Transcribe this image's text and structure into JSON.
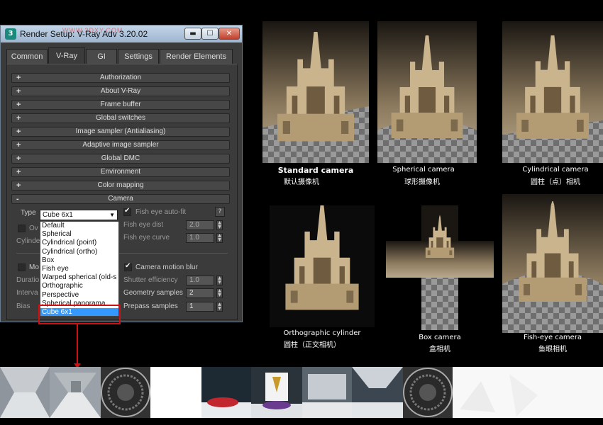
{
  "window": {
    "title": "Render Setup: V-Ray Adv 3.20.02",
    "watermark": "WWW.3DXY.COM",
    "buttons": {
      "minimize": "▬",
      "maximize": "☐",
      "close": "✕"
    }
  },
  "tabs": [
    "Common",
    "V-Ray",
    "GI",
    "Settings",
    "Render Elements"
  ],
  "active_tab": "V-Ray",
  "rollouts": [
    {
      "sign": "+",
      "label": "Authorization"
    },
    {
      "sign": "+",
      "label": "About V-Ray"
    },
    {
      "sign": "+",
      "label": "Frame buffer"
    },
    {
      "sign": "+",
      "label": "Global switches"
    },
    {
      "sign": "+",
      "label": "Image sampler (Antialiasing)"
    },
    {
      "sign": "+",
      "label": "Adaptive image sampler"
    },
    {
      "sign": "+",
      "label": "Global DMC"
    },
    {
      "sign": "+",
      "label": "Environment"
    },
    {
      "sign": "+",
      "label": "Color mapping"
    },
    {
      "sign": "-",
      "label": "Camera"
    }
  ],
  "camera": {
    "type_label": "Type",
    "type_value": "Cube 6x1",
    "fish_eye_autofit": "Fish eye auto-fit",
    "fish_eye_autofit_checked": true,
    "fish_eye_dist_label": "Fish eye dist",
    "fish_eye_dist": "2.0",
    "fish_eye_curve_label": "Fish eye curve",
    "fish_eye_curve": "1.0",
    "override_fov_partial": "Ov",
    "cylinder_partial": "Cylinde",
    "help_label": "?",
    "options": [
      "Default",
      "Spherical",
      "Cylindrical (point)",
      "Cylindrical (ortho)",
      "Box",
      "Fish eye",
      "Warped spherical (old-s",
      "Orthographic",
      "Perspective",
      "Spherical panorama",
      "Cube 6x1"
    ],
    "selected_option": "Cube 6x1"
  },
  "motion": {
    "motion_blur_partial": "Mo",
    "duration_partial": "Duratio",
    "interval_partial": "Interva",
    "bias_label": "Bias",
    "camera_motion_blur": "Camera motion blur",
    "camera_motion_blur_checked": true,
    "shutter_label": "Shutter efficiency",
    "shutter_value": "1.0",
    "geometry_label": "Geometry samples",
    "geometry_value": "2",
    "prepass_label": "Prepass samples",
    "prepass_value": "1"
  },
  "cameras": [
    {
      "en": "Standard camera",
      "zh": "默认摄像机"
    },
    {
      "en": "Spherical camera",
      "zh": "球形摄像机"
    },
    {
      "en": "Cylindrical camera",
      "zh": "圆柱（点）相机"
    },
    {
      "en": "Orthographic cylinder",
      "zh": "圆柱（正交相机）"
    },
    {
      "en": "Box camera",
      "zh": "盒相机"
    },
    {
      "en": "Fish-eye camera",
      "zh": "鱼眼相机"
    }
  ],
  "colors": {
    "accent_red": "#d01010",
    "selection_blue": "#3399ff",
    "panel_gray": "#3b3b3b",
    "cathedral_tan": "#c9b48e"
  }
}
